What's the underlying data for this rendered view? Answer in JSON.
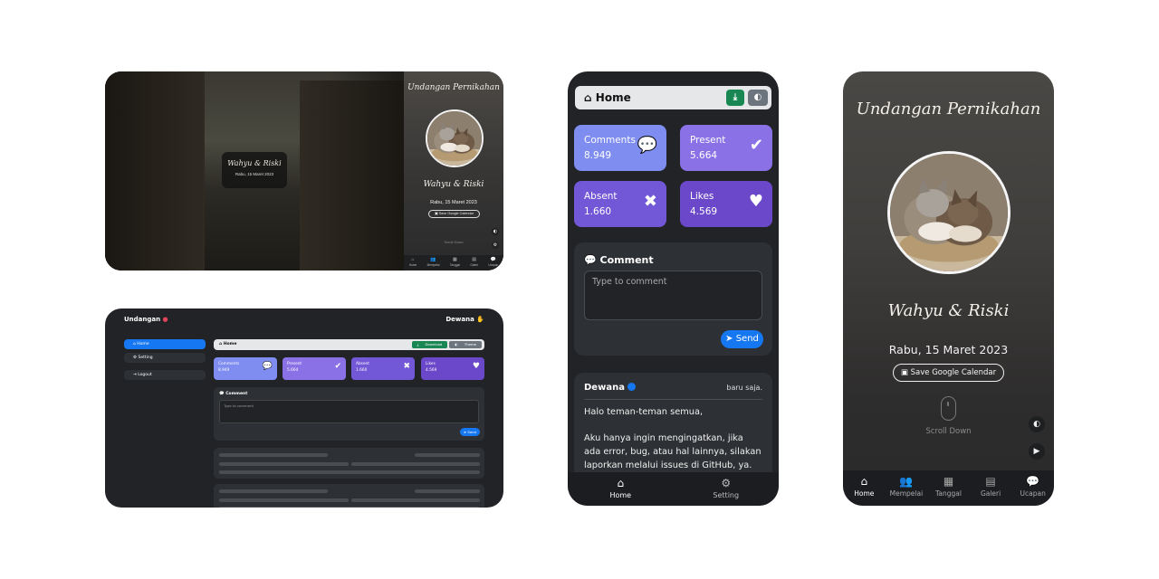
{
  "colors": {
    "comments_card": "#7f8cf0",
    "present_card": "#8a72e6",
    "absent_card": "#7257d6",
    "likes_card": "#6b47c9",
    "primary": "#1677f2",
    "download_btn": "#198754",
    "theme_btn": "#6c757d",
    "dark_bg": "#212326",
    "panel_bg": "#2d3034"
  },
  "desktop_landing": {
    "couple_card_names": "Wahyu & Riski",
    "couple_card_date": "Rabu, 15 Maret 2023",
    "side_title": "Undangan Pernikahan",
    "side_names": "Wahyu & Riski",
    "side_date": "Rabu, 15 Maret 2023",
    "side_calendar_btn": "Save Google Calendar",
    "side_scroll": "Scroll Down",
    "nav": [
      {
        "label": "Home",
        "icon": "home-icon"
      },
      {
        "label": "Mempelai",
        "icon": "users-icon"
      },
      {
        "label": "Tanggal",
        "icon": "calendar-icon"
      },
      {
        "label": "Galeri",
        "icon": "gallery-icon"
      },
      {
        "label": "Ucapan",
        "icon": "comments-icon"
      }
    ]
  },
  "desktop_dashboard": {
    "brand": "Undangan",
    "user": "Dewana",
    "sidebar": [
      {
        "label": "Home",
        "icon": "home-icon"
      },
      {
        "label": "Setting",
        "icon": "gear-icon"
      },
      {
        "label": "Logout",
        "icon": "logout-icon"
      }
    ],
    "topbar_title": "Home",
    "download_label": "Download",
    "theme_label": "Theme",
    "stats": [
      {
        "label": "Comments",
        "value": "8.949"
      },
      {
        "label": "Present",
        "value": "5.664"
      },
      {
        "label": "Absent",
        "value": "1.660"
      },
      {
        "label": "Likes",
        "value": "4.569"
      }
    ],
    "comment_label": "Comment",
    "comment_placeholder": "Type to comment",
    "send_label": "Send"
  },
  "mobile_dashboard": {
    "topbar_title": "Home",
    "stats": [
      {
        "label": "Comments",
        "value": "8.949"
      },
      {
        "label": "Present",
        "value": "5.664"
      },
      {
        "label": "Absent",
        "value": "1.660"
      },
      {
        "label": "Likes",
        "value": "4.569"
      }
    ],
    "comment_label": "Comment",
    "comment_placeholder": "Type to comment",
    "send_label": "Send",
    "post": {
      "author": "Dewana",
      "time": "baru saja.",
      "line1": "Halo teman-teman semua,",
      "line2": "Aku hanya ingin mengingatkan, jika ada error, bug, atau hal lainnya, silakan laporkan melalui issues di GitHub, ya."
    },
    "nav": [
      {
        "label": "Home",
        "icon": "home-icon"
      },
      {
        "label": "Setting",
        "icon": "gear-icon"
      }
    ]
  },
  "mobile_landing": {
    "title": "Undangan Pernikahan",
    "names": "Wahyu & Riski",
    "date": "Rabu, 15 Maret 2023",
    "calendar_btn": "Save Google Calendar",
    "scroll": "Scroll Down",
    "nav": [
      {
        "label": "Home",
        "icon": "home-icon"
      },
      {
        "label": "Mempelai",
        "icon": "users-icon"
      },
      {
        "label": "Tanggal",
        "icon": "calendar-icon"
      },
      {
        "label": "Galeri",
        "icon": "gallery-icon"
      },
      {
        "label": "Ucapan",
        "icon": "comments-icon"
      }
    ]
  }
}
